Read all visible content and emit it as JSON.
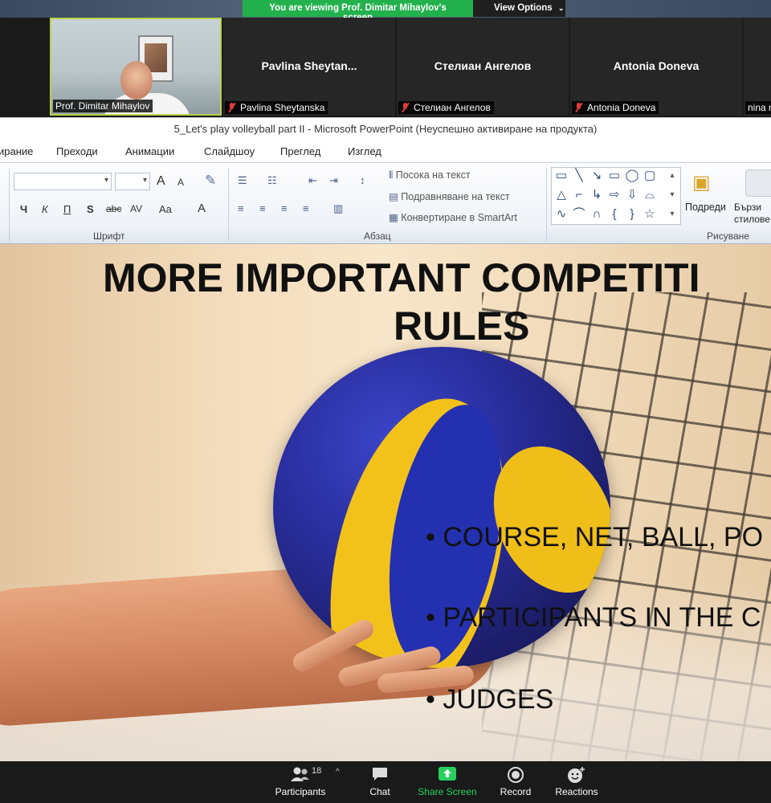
{
  "banner": {
    "viewing_text": "You are viewing Prof. Dimitar Mihaylov's screen",
    "view_options": "View Options",
    "accent": "#23b14d"
  },
  "participants_strip": {
    "tiles": [
      {
        "label": "Prof. Dimitar Mihaylov",
        "video": true,
        "muted": false
      },
      {
        "center_name": "Pavlina  Sheytan...",
        "label": "Pavlina Sheytanska",
        "muted": true
      },
      {
        "center_name": "Стелиан Ангелов",
        "label": "Стелиан Ангелов",
        "muted": true
      },
      {
        "center_name": "Antonia Doneva",
        "label": "Antonia Doneva",
        "muted": true
      },
      {
        "label": "nina m",
        "muted": false
      }
    ]
  },
  "ppt": {
    "window_title": "5_Let's play volleyball part II  -  Microsoft PowerPoint (Неуспешно активиране на продукта)",
    "tabs": [
      "ирание",
      "Преходи",
      "Анимации",
      "Слайдшоу",
      "Преглед",
      "Изглед"
    ],
    "ribbon": {
      "font_group_label": "Шрифт",
      "paragraph_group_label": "Абзац",
      "drawing_group_label": "Рисуване",
      "text_direction": "Посока на текст",
      "align_text": "Подравняване на текст",
      "convert_smartart": "Конвертиране в SmartArt",
      "arrange": "Подреди",
      "quick_styles": "Бързи стилове",
      "bold": "Ч",
      "italic": "К",
      "underline": "П",
      "shadow": "S",
      "strike": "abc",
      "spacing": "AV",
      "case": "Aa",
      "font_color": "A",
      "grow_font": "A",
      "shrink_font": "A"
    }
  },
  "slide": {
    "title_line1": "MORE IMPORTANT COMPETITI",
    "title_line2": "RULES",
    "bullets": [
      "• COURSE, NET, BALL, PO",
      "• PARTICIPANTS  IN THE C",
      "• JUDGES"
    ]
  },
  "controls": {
    "participants_label": "Participants",
    "participants_count": "18",
    "chat_label": "Chat",
    "share_label": "Share Screen",
    "record_label": "Record",
    "reactions_label": "Reactions",
    "share_color": "#26d15e"
  }
}
